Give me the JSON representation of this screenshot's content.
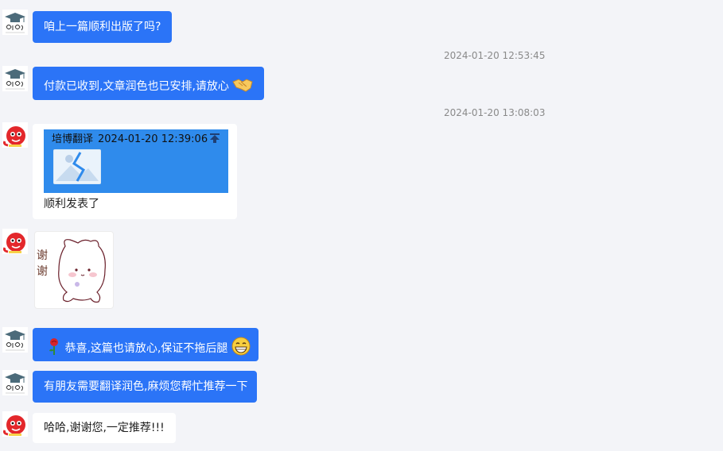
{
  "messages": {
    "m1": {
      "text": "咱上一篇顺利出版了吗?"
    },
    "ts1": "2024-01-20 12:53:45",
    "m2": {
      "text": "付款已收到,文章润色也已安排,请放心",
      "emoji": "handshake-emoji"
    },
    "ts2": "2024-01-20 13:08:03",
    "m3": {
      "quote": {
        "sender": "培博翻译",
        "time": "2024-01-20 12:39:06",
        "image_icon": "image-placeholder-icon"
      },
      "text": "顺利发表了"
    },
    "m4": {
      "sticker_text": "谢谢"
    },
    "m5": {
      "text": "恭喜,这篇也请放心,保证不拖后腿",
      "emoji_left": "rose-emoji",
      "emoji_right": "grin-emoji"
    },
    "m6": {
      "text": "有朋友需要翻译润色,麻烦您帮忙推荐一下"
    },
    "m7": {
      "text": "哈哈,谢谢您,一定推荐!!!"
    }
  },
  "colors": {
    "background": "#f3f4f8",
    "bubble_blue": "#2b74f7",
    "bubble_white": "#ffffff",
    "quote_blue": "#2f8bec",
    "timestamp": "#8a8a8a"
  }
}
